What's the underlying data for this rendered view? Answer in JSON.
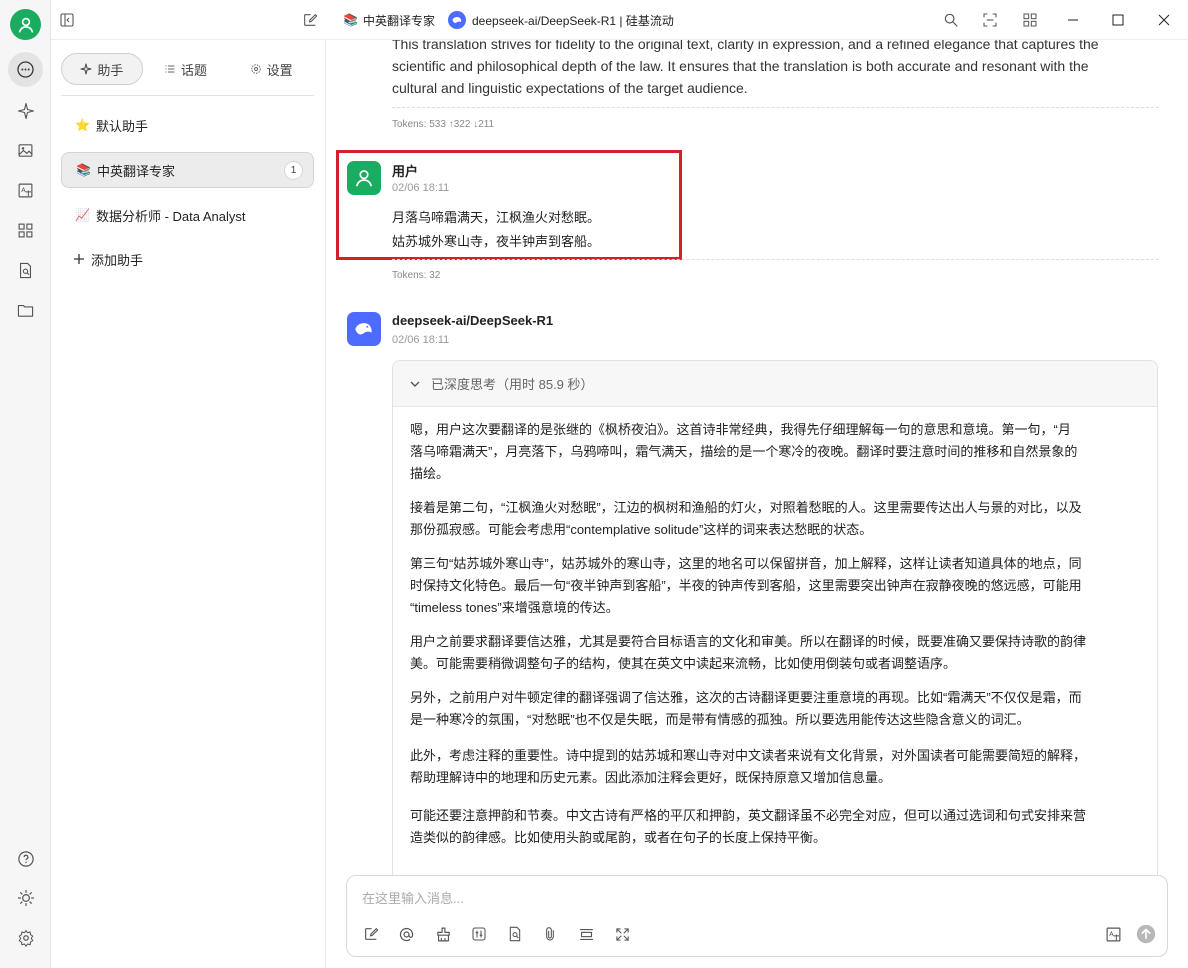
{
  "window": {
    "tab_assistant": "中英翻译专家",
    "tab_model": "deepseek-ai/DeepSeek-R1 | 硅基流动"
  },
  "rail": {
    "icons": [
      "user-avatar-icon",
      "chat-icon",
      "sparkle-icon",
      "image-icon",
      "translate-icon",
      "apps-icon",
      "knowledge-icon",
      "folder-icon",
      "help-icon",
      "theme-icon",
      "settings-icon"
    ]
  },
  "panel": {
    "tabs": [
      {
        "label": "助手",
        "icon": "sparkle-icon"
      },
      {
        "label": "话题",
        "icon": "list-icon"
      },
      {
        "label": "设置",
        "icon": "gear-icon"
      }
    ],
    "assistants": [
      {
        "emoji": "⭐",
        "label": "默认助手"
      },
      {
        "emoji": "📚",
        "label": "中英翻译专家",
        "count": "1"
      },
      {
        "emoji": "📈",
        "label": "数据分析师 - Data Analyst"
      }
    ],
    "add_label": "添加助手"
  },
  "chat": {
    "prev_text_line1": "This translation strives for fidelity to the original text, clarity in expression, and a refined elegance that captures the",
    "prev_text_line2": "scientific and philosophical depth of the law. It ensures that the translation is both accurate and resonant with the",
    "prev_text_line3": "cultural and linguistic expectations of the target audience.",
    "prev_tokens": "Tokens: 533 ↑322 ↓211",
    "user": {
      "name": "用户",
      "time": "02/06 18:11",
      "line1": "月落乌啼霜满天，江枫渔火对愁眠。",
      "line2": "姑苏城外寒山寺，夜半钟声到客船。",
      "tokens": "Tokens: 32"
    },
    "assistant": {
      "name": "deepseek-ai/DeepSeek-R1",
      "time": "02/06 18:11",
      "think_label": "已深度思考（用时 85.9 秒）",
      "paragraphs": [
        [
          "嗯，用户这次要翻译的是张继的《枫桥夜泊》。这首诗非常经典，我得先仔细理解每一句的意思和意境。第一句，“月",
          "落乌啼霜满天”，月亮落下，乌鸦啼叫，霜气满天，描绘的是一个寒冷的夜晚。翻译时要注意时间的推移和自然景象的",
          "描绘。"
        ],
        [
          "接着是第二句，“江枫渔火对愁眠”，江边的枫树和渔船的灯火，对照着愁眠的人。这里需要传达出人与景的对比，以及",
          "那份孤寂感。可能会考虑用“contemplative solitude”这样的词来表达愁眠的状态。"
        ],
        [
          "第三句“姑苏城外寒山寺”，姑苏城外的寒山寺，这里的地名可以保留拼音，加上解释，这样让读者知道具体的地点，同",
          "时保持文化特色。最后一句“夜半钟声到客船”，半夜的钟声传到客船，这里需要突出钟声在寂静夜晚的悠远感，可能用",
          "“timeless tones”来增强意境的传达。"
        ],
        [
          "用户之前要求翻译要信达雅，尤其是要符合目标语言的文化和审美。所以在翻译的时候，既要准确又要保持诗歌的韵律",
          "美。可能需要稍微调整句子的结构，使其在英文中读起来流畅，比如使用倒装句或者调整语序。"
        ],
        [
          "另外，之前用户对牛顿定律的翻译强调了信达雅，这次的古诗翻译更要注重意境的再现。比如“霜满天”不仅仅是霜，而",
          "是一种寒冷的氛围，“对愁眠”也不仅是失眠，而是带有情感的孤独。所以要选用能传达这些隐含意义的词汇。"
        ],
        [
          "此外，考虑注释的重要性。诗中提到的姑苏城和寒山寺对中文读者来说有文化背景，对外国读者可能需要简短的解释，",
          "帮助理解诗中的地理和历史元素。因此添加注释会更好，既保持原意又增加信息量。"
        ],
        [
          "可能还要注意押韵和节奏。中文古诗有严格的平仄和押韵，英文翻译虽不必完全对应，但可以通过选词和句式安排来营",
          "造类似的韵律感。比如使用头韵或尾韵，或者在句子的长度上保持平衡。"
        ]
      ]
    }
  },
  "input": {
    "placeholder": "在这里输入消息..."
  },
  "colors": {
    "accent_green": "#1aad62",
    "deepseek_blue": "#4d6bfe",
    "highlight_red": "#d51f2a"
  }
}
